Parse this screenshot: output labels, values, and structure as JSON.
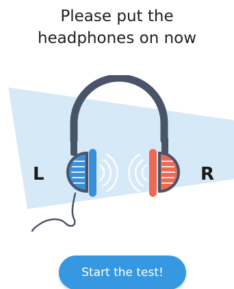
{
  "prompt": {
    "line1": "Please put the",
    "line2": "headphones on now"
  },
  "channels": {
    "left_label": "L",
    "right_label": "R"
  },
  "actions": {
    "start_label": "Start the test!"
  },
  "colors": {
    "accent": "#3598e0",
    "left_cup": "#3a8fd9",
    "right_cup": "#ec6a52",
    "headband": "#4a5468",
    "sound_beam": "#d6e9f7"
  },
  "icons": {
    "headphones": "headphones-icon",
    "left_sound": "sound-waves-icon",
    "right_sound": "sound-waves-icon"
  }
}
